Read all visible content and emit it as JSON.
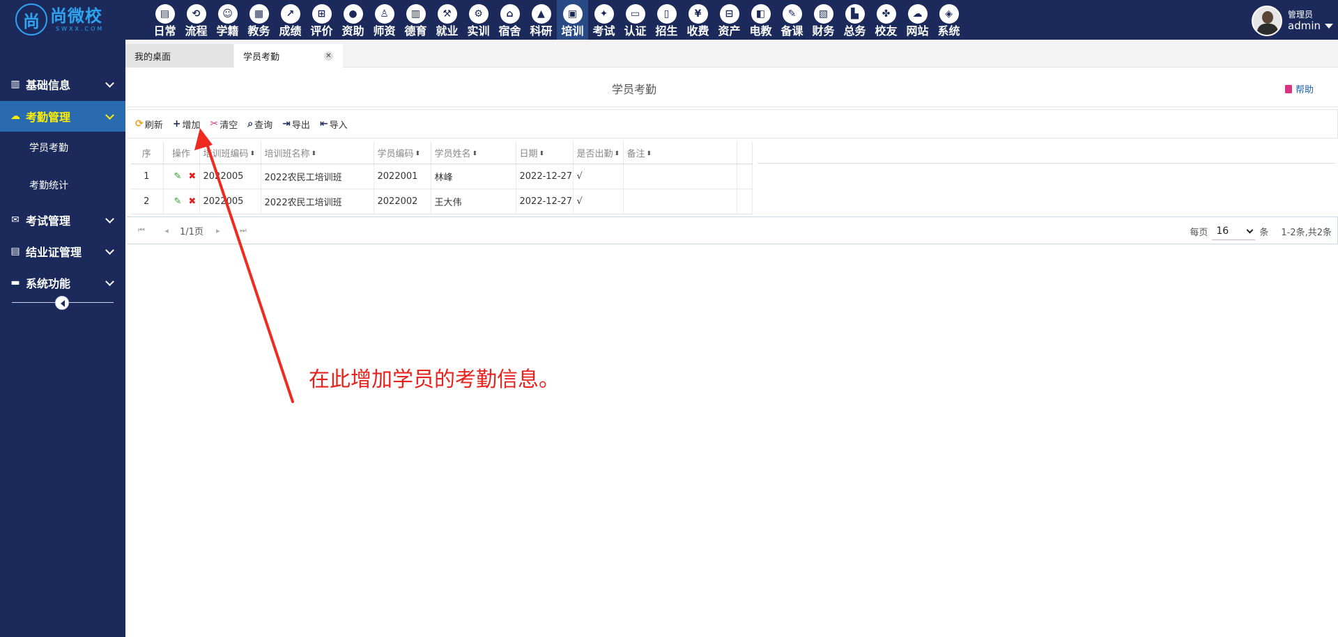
{
  "brand": {
    "logo_glyph": "尚",
    "name": "尚微校",
    "sub": "SWXX.COM"
  },
  "modules": [
    {
      "label": "日常",
      "icon": "document-icon"
    },
    {
      "label": "流程",
      "icon": "flow-icon"
    },
    {
      "label": "学籍",
      "icon": "student-icon"
    },
    {
      "label": "教务",
      "icon": "calendar-icon"
    },
    {
      "label": "成绩",
      "icon": "chart-icon"
    },
    {
      "label": "评价",
      "icon": "calendar-plus-icon"
    },
    {
      "label": "资助",
      "icon": "user-icon"
    },
    {
      "label": "师资",
      "icon": "teacher-icon"
    },
    {
      "label": "德育",
      "icon": "book-icon"
    },
    {
      "label": "就业",
      "icon": "gavel-icon"
    },
    {
      "label": "实训",
      "icon": "robot-icon"
    },
    {
      "label": "宿舍",
      "icon": "home-icon"
    },
    {
      "label": "科研",
      "icon": "graduation-icon"
    },
    {
      "label": "培训",
      "icon": "image-icon",
      "active": true
    },
    {
      "label": "考试",
      "icon": "wrench-icon"
    },
    {
      "label": "认证",
      "icon": "monitor-icon"
    },
    {
      "label": "招生",
      "icon": "bus-icon"
    },
    {
      "label": "收费",
      "icon": "yen-icon"
    },
    {
      "label": "资产",
      "icon": "train-icon"
    },
    {
      "label": "电教",
      "icon": "film-icon"
    },
    {
      "label": "备课",
      "icon": "edit-icon"
    },
    {
      "label": "财务",
      "icon": "newspaper-icon"
    },
    {
      "label": "总务",
      "icon": "stats-icon"
    },
    {
      "label": "校友",
      "icon": "users-icon"
    },
    {
      "label": "网站",
      "icon": "cloud-icon"
    },
    {
      "label": "系统",
      "icon": "cube-icon"
    }
  ],
  "user": {
    "role": "管理员",
    "name": "admin"
  },
  "sidebar": {
    "groups": [
      {
        "label": "基础信息",
        "icon": "book-icon"
      },
      {
        "label": "考勤管理",
        "icon": "cloud-icon",
        "active": true
      },
      {
        "label": "考试管理",
        "icon": "envelope-icon"
      },
      {
        "label": "结业证管理",
        "icon": "file-icon"
      },
      {
        "label": "系统功能",
        "icon": "folder-icon"
      }
    ],
    "subs": [
      {
        "label": "学员考勤"
      },
      {
        "label": "考勤统计"
      }
    ]
  },
  "tabs": [
    {
      "label": "我的桌面"
    },
    {
      "label": "学员考勤",
      "active": true
    }
  ],
  "page": {
    "title": "学员考勤",
    "help": "帮助"
  },
  "toolbar": {
    "refresh": "刷新",
    "add": "增加",
    "clear": "清空",
    "query": "查询",
    "export": "导出",
    "import": "导入"
  },
  "table": {
    "columns": [
      "序",
      "操作",
      "培训班编码",
      "培训班名称",
      "学员编码",
      "学员姓名",
      "日期",
      "是否出勤",
      "备注"
    ],
    "rows": [
      [
        "1",
        "",
        "2022005",
        "2022农民工培训班",
        "2022001",
        "林峰",
        "2022-12-27",
        "√",
        ""
      ],
      [
        "2",
        "",
        "2022005",
        "2022农民工培训班",
        "2022002",
        "王大伟",
        "2022-12-27",
        "√",
        ""
      ]
    ]
  },
  "pager": {
    "page_info": "1/1页",
    "per_page_label": "每页",
    "per_page_value": "16",
    "unit": "条",
    "total": "1-2条,共2条"
  },
  "annotation": {
    "text": "在此增加学员的考勤信息。",
    "color": "#e8221c"
  },
  "colors": {
    "nav_bg": "#1b2a5a",
    "sidebar_active": "#2a6bb0",
    "active_text": "#fff000"
  }
}
